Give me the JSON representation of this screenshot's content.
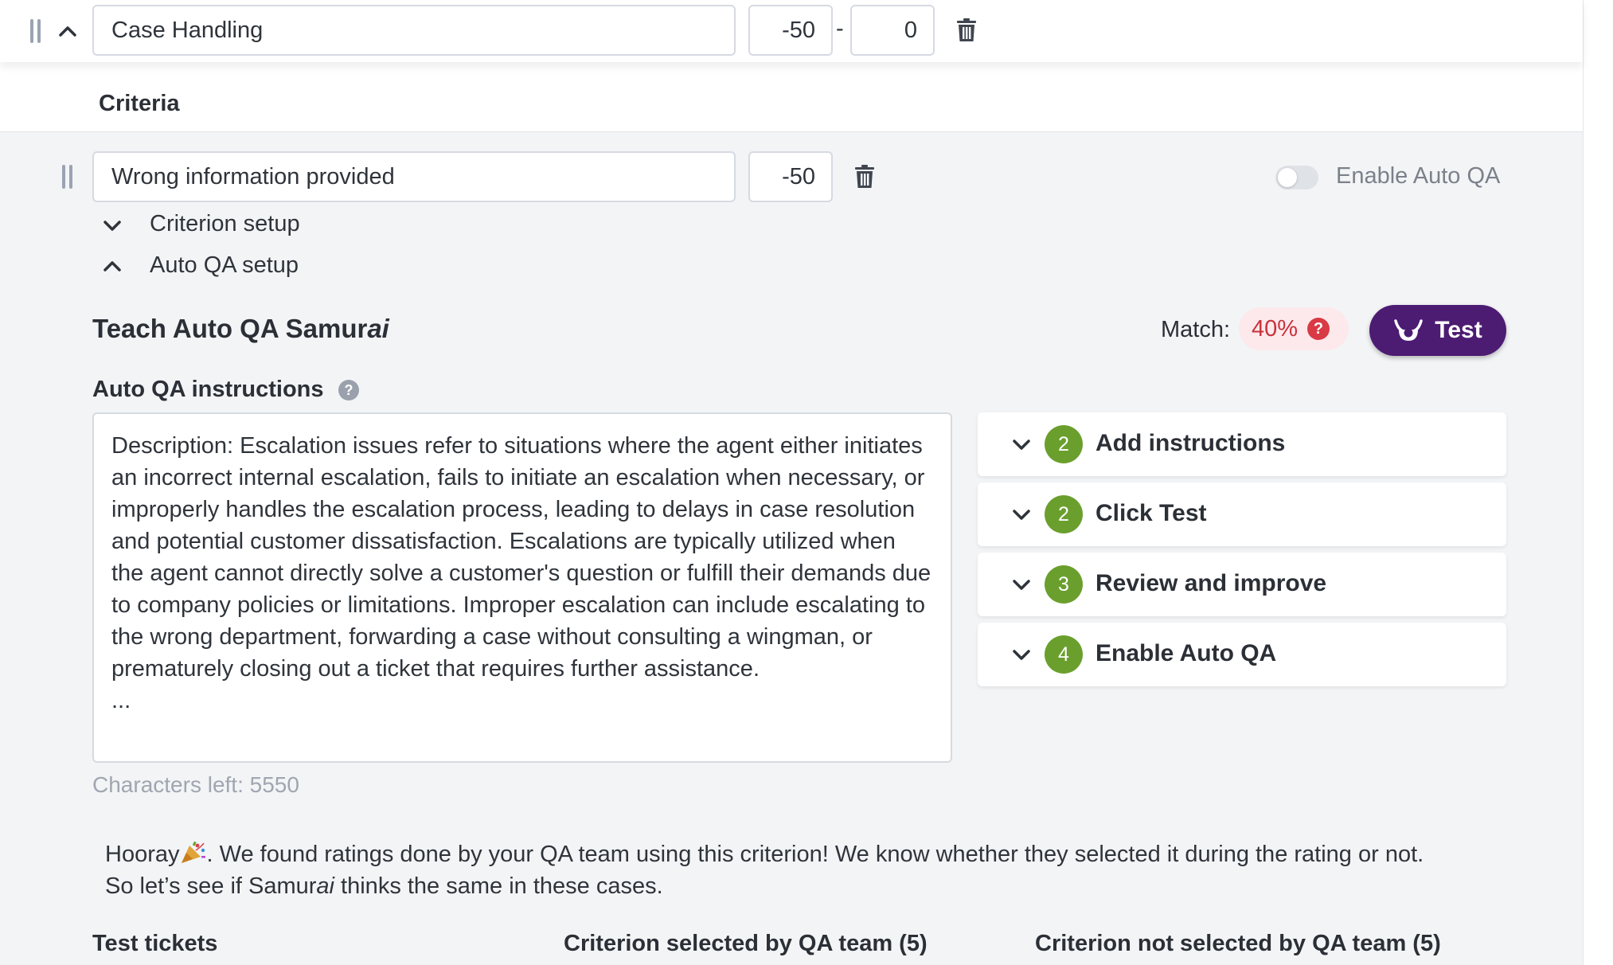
{
  "category": {
    "name": "Case Handling",
    "min_score": "-50",
    "range_separator": "-",
    "max_score": "0"
  },
  "criteria_section": {
    "title": "Criteria"
  },
  "criterion": {
    "name": "Wrong information provided",
    "score": "-50",
    "enable_auto_qa_label": "Enable Auto QA",
    "enable_auto_qa_on": false,
    "criterion_setup_label": "Criterion setup",
    "auto_qa_setup_label": "Auto QA setup"
  },
  "teach": {
    "title_prefix": "Teach Auto QA Samur",
    "title_suffix": "ai",
    "match_label": "Match:",
    "match_value": "40%",
    "test_button": "Test"
  },
  "instructions": {
    "label": "Auto QA instructions",
    "text": "Description: Escalation issues refer to situations where the agent either initiates an incorrect internal escalation, fails to initiate an escalation when necessary, or improperly handles the escalation process, leading to delays in case resolution and potential customer dissatisfaction. Escalations are typically utilized when the agent cannot directly solve a customer's question or fulfill their demands due to company policies or limitations. Improper escalation can include escalating to the wrong department, forwarding a case without consulting a wingman, or prematurely closing out a ticket that requires further assistance.\n...",
    "chars_left": "Characters left: 5550"
  },
  "steps": [
    {
      "number": "2",
      "label": "Add instructions"
    },
    {
      "number": "2",
      "label": "Click Test"
    },
    {
      "number": "3",
      "label": "Review and improve"
    },
    {
      "number": "4",
      "label": "Enable Auto QA"
    }
  ],
  "hooray": {
    "part1": "Hooray",
    "part2": ". We found ratings done by your QA team using this criterion!  We know whether they selected it during the rating or not.",
    "part3": "So let’s see if Samur",
    "part4": "ai",
    "part5": " thinks the same in these cases."
  },
  "columns": {
    "test_tickets": "Test tickets",
    "selected": "Criterion selected by QA team (5)",
    "not_selected": "Criterion not selected by QA team (5)"
  },
  "colors": {
    "accent_purple": "#4c1b72",
    "step_green": "#6a9f2d",
    "match_red": "#c8323c"
  }
}
